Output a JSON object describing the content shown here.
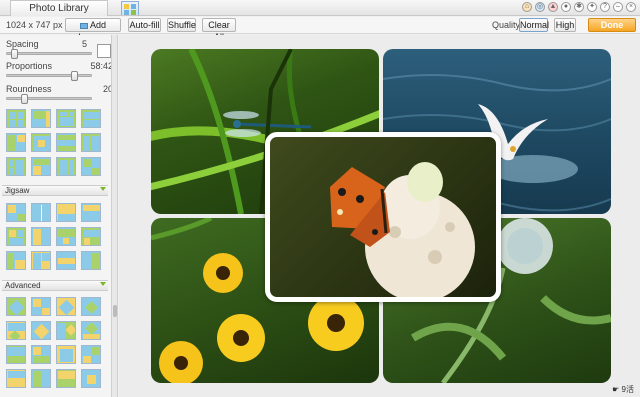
{
  "tabs": {
    "photo_library": "Photo Library"
  },
  "toolbar": {
    "dimensions": "1024 x 747 px",
    "add_images": "Add Images",
    "auto_fill": "Auto-fill",
    "shuffle": "Shuffle",
    "clear_all": "Clear All",
    "quality_label": "Quality:",
    "quality_normal": "Normal",
    "quality_high": "High",
    "done": "Done"
  },
  "sidebar": {
    "spacing_label": "Spacing",
    "spacing_value": "5",
    "spacing_fraction": 0.05,
    "proportions_label": "Proportions",
    "proportions_value": "58:42",
    "proportions_fraction": 0.78,
    "roundness_label": "Roundness",
    "roundness_value": "20",
    "roundness_fraction": 0.2,
    "section_jigsaw": "Jigsaw",
    "section_advanced": "Advanced"
  },
  "status": {
    "text": "☛ 9活"
  },
  "colors": {
    "accent": "#f5a623",
    "section_chevron": "#7ab62a",
    "tile_blue": "#8ccbe8",
    "tile_yellow": "#f3d36b",
    "tile_green": "#a9d36a"
  }
}
